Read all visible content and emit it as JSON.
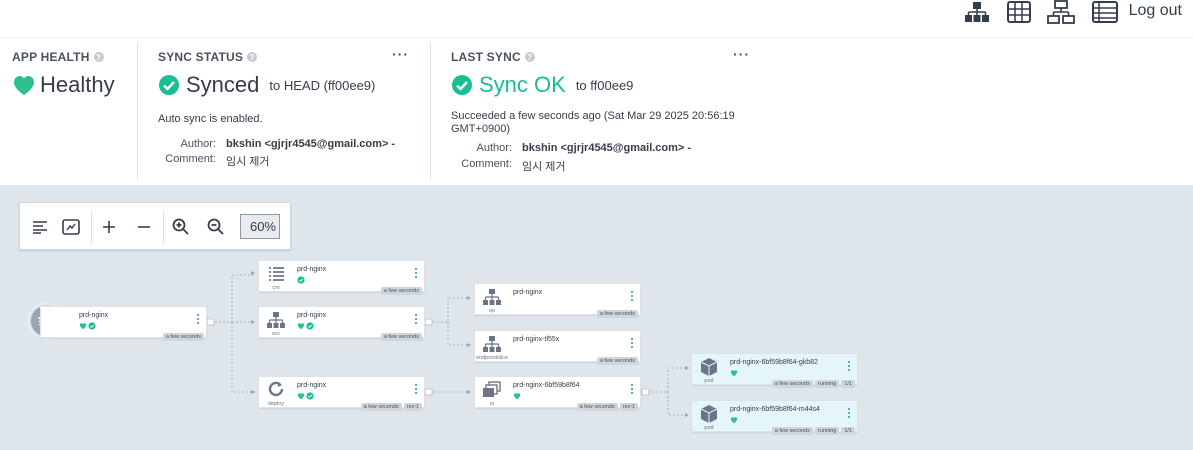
{
  "nav": {
    "logout": "Log out"
  },
  "colors": {
    "healthy": "#2dc08d",
    "synced": "#18be94",
    "text": "#363c4a",
    "graph_bg": "#dee6eb"
  },
  "app_health": {
    "title": "APP HEALTH",
    "status": "Healthy"
  },
  "sync_status": {
    "title": "SYNC STATUS",
    "status": "Synced",
    "target": "to HEAD (ff00ee9)",
    "note": "Auto sync is enabled.",
    "author_label": "Author:",
    "author": "bkshin <gjrjr4545@gmail.com> -",
    "comment_label": "Comment:",
    "comment": "임시 제거"
  },
  "last_sync": {
    "title": "LAST SYNC",
    "status": "Sync OK",
    "target": "to ff00ee9",
    "result_line1": "Succeeded a few seconds ago (Sat Mar 29 2025 20:56:19",
    "result_line2": "GMT+0900)",
    "author_label": "Author:",
    "author": "bkshin <gjrjr4545@gmail.com> -",
    "comment_label": "Comment:",
    "comment": "임시 제거"
  },
  "toolbar": {
    "zoom": "60%"
  },
  "nodes": {
    "app": {
      "name": "prd-nginx",
      "tags": [
        "a few seconds"
      ]
    },
    "cm": {
      "name": "prd-nginx",
      "kind": "cm",
      "tags": [
        "a few seconds"
      ]
    },
    "svc": {
      "name": "prd-nginx",
      "kind": "svc",
      "tags": [
        "a few seconds"
      ]
    },
    "deploy": {
      "name": "prd-nginx",
      "kind": "deploy",
      "tags": [
        "a few seconds",
        "rev:1"
      ]
    },
    "ep": {
      "name": "prd-nginx",
      "kind": "ep",
      "tags": [
        "a few seconds"
      ]
    },
    "endpointslice": {
      "name": "prd-nginx-tl55x",
      "kind": "endpointslice",
      "tags": [
        "a few seconds"
      ]
    },
    "rs": {
      "name": "prd-nginx-6bf59b8f64",
      "kind": "rs",
      "tags": [
        "a few seconds",
        "rev:1"
      ]
    },
    "pod1": {
      "name": "prd-nginx-6bf59b8f64-gkb82",
      "kind": "pod",
      "tags": [
        "a few seconds",
        "running",
        "1/1"
      ]
    },
    "pod2": {
      "name": "prd-nginx-6bf59b8f64-m44s4",
      "kind": "pod",
      "tags": [
        "a few seconds",
        "running",
        "1/1"
      ]
    }
  }
}
